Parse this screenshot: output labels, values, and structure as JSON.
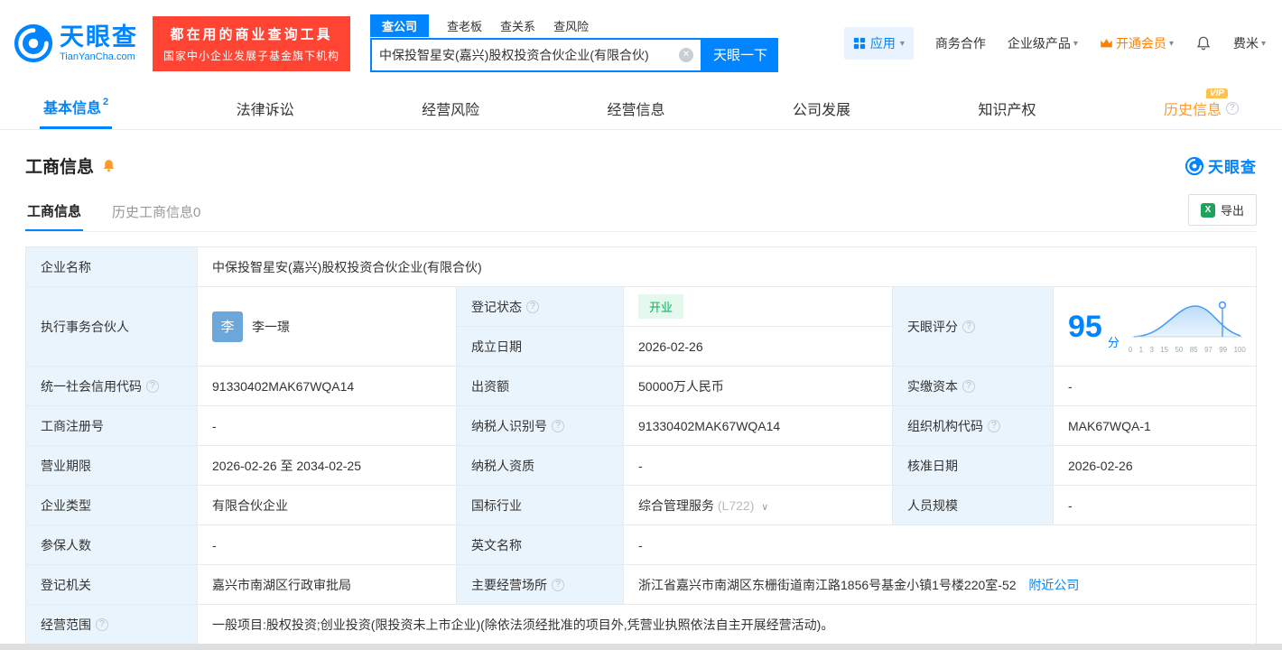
{
  "brand": {
    "name": "天眼查",
    "domain": "TianYanCha.com"
  },
  "promo": {
    "line1": "都在用的商业查询工具",
    "line2": "国家中小企业发展子基金旗下机构"
  },
  "search": {
    "tabs": [
      {
        "label": "查公司"
      },
      {
        "label": "查老板"
      },
      {
        "label": "查关系"
      },
      {
        "label": "查风险"
      }
    ],
    "value": "中保投智星安(嘉兴)股权投资合伙企业(有限合伙)",
    "button": "天眼一下"
  },
  "topnav": {
    "apps": "应用",
    "biz": "商务合作",
    "enterprise": "企业级产品",
    "vip": "开通会员",
    "user": "费米"
  },
  "tabs": {
    "basic": "基本信息",
    "basic_count": "2",
    "legal": "法律诉讼",
    "risk": "经营风险",
    "operation": "经营信息",
    "development": "公司发展",
    "ip": "知识产权",
    "history": "历史信息",
    "history_vip": "VIP"
  },
  "section": {
    "title": "工商信息",
    "tab1": "工商信息",
    "tab2": "历史工商信息0",
    "export": "导出",
    "logo": "天眼查"
  },
  "fields": {
    "company_name_label": "企业名称",
    "company_name": "中保投智星安(嘉兴)股权投资合伙企业(有限合伙)",
    "partner_label": "执行事务合伙人",
    "partner_avatar": "李",
    "partner_name": "李一璟",
    "reg_status_label": "登记状态",
    "reg_status": "开业",
    "score_label": "天眼评分",
    "establish_date_label": "成立日期",
    "establish_date": "2026-02-26",
    "credit_code_label": "统一社会信用代码",
    "credit_code": "91330402MAK67WQA14",
    "capital_label": "出资额",
    "capital": "50000万人民币",
    "paid_capital_label": "实缴资本",
    "paid_capital": "-",
    "reg_number_label": "工商注册号",
    "reg_number": "-",
    "taxpayer_id_label": "纳税人识别号",
    "taxpayer_id": "91330402MAK67WQA14",
    "org_code_label": "组织机构代码",
    "org_code": "MAK67WQA-1",
    "business_term_label": "营业期限",
    "business_term": "2026-02-26 至 2034-02-25",
    "taxpayer_quality_label": "纳税人资质",
    "taxpayer_quality": "-",
    "approval_date_label": "核准日期",
    "approval_date": "2026-02-26",
    "company_type_label": "企业类型",
    "company_type": "有限合伙企业",
    "industry_label": "国标行业",
    "industry": "综合管理服务",
    "industry_code": "(L722)",
    "staff_size_label": "人员规模",
    "staff_size": "-",
    "insured_label": "参保人数",
    "insured": "-",
    "english_name_label": "英文名称",
    "english_name": "-",
    "reg_authority_label": "登记机关",
    "reg_authority": "嘉兴市南湖区行政审批局",
    "business_place_label": "主要经营场所",
    "business_place": "浙江省嘉兴市南湖区东栅街道南江路1856号基金小镇1号楼220室-52",
    "nearby_link": "附近公司",
    "business_scope_label": "经营范围",
    "business_scope": "一般项目:股权投资;创业投资(限投资未上市企业)(除依法须经批准的项目外,凭营业执照依法自主开展经营活动)。"
  },
  "score": {
    "value": "95",
    "unit": "分",
    "ticks": [
      "0",
      "1",
      "3",
      "15",
      "50",
      "85",
      "97",
      "99",
      "100"
    ]
  },
  "icons": {
    "caret": "▾",
    "clear": "✕",
    "chevron": "∨",
    "excel": "X",
    "help": "?"
  },
  "colors": {
    "brand_blue": "#0084ff",
    "promo_red": "#ff4433",
    "vip_orange": "#ff8000",
    "history_orange": "#ff9a2e",
    "open_green": "#00b35a",
    "label_bg": "#e9f4fc"
  }
}
